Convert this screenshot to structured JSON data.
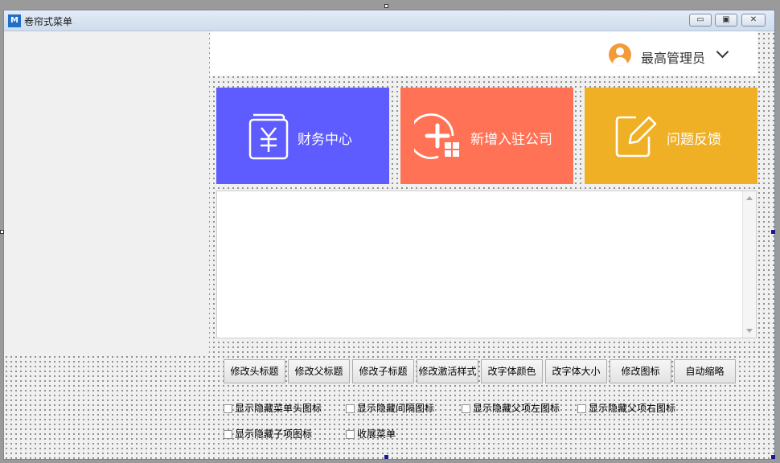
{
  "window": {
    "title": "卷帘式菜单",
    "controls": {
      "minimize": "▭",
      "maximize": "▣",
      "close": "✕"
    }
  },
  "header": {
    "user_name": "最高管理员",
    "avatar_icon": "user-avatar-icon",
    "dropdown_icon": "chevron-down-icon"
  },
  "cards": [
    {
      "label": "财务中心",
      "color": "#5e5bff",
      "icon": "finance-document-icon"
    },
    {
      "label": "新增入驻公司",
      "color": "#ff7256",
      "icon": "add-company-icon"
    },
    {
      "label": "问题反馈",
      "color": "#f0b026",
      "icon": "edit-feedback-icon"
    }
  ],
  "buttons": [
    "修改头标题",
    "修改父标题",
    "修改子标题",
    "修改激活样式",
    "改字体颜色",
    "改字体大小",
    "修改图标",
    "自动缩略"
  ],
  "checkboxes": [
    {
      "label": "显示隐藏菜单头图标",
      "checked": false
    },
    {
      "label": "显示隐藏间隔图标",
      "checked": false
    },
    {
      "label": "显示隐藏父项左图标",
      "checked": false
    },
    {
      "label": "显示隐藏父项右图标",
      "checked": false
    },
    {
      "label": "显示隐藏子项图标",
      "checked": false
    },
    {
      "label": "收展菜单",
      "checked": false
    }
  ]
}
